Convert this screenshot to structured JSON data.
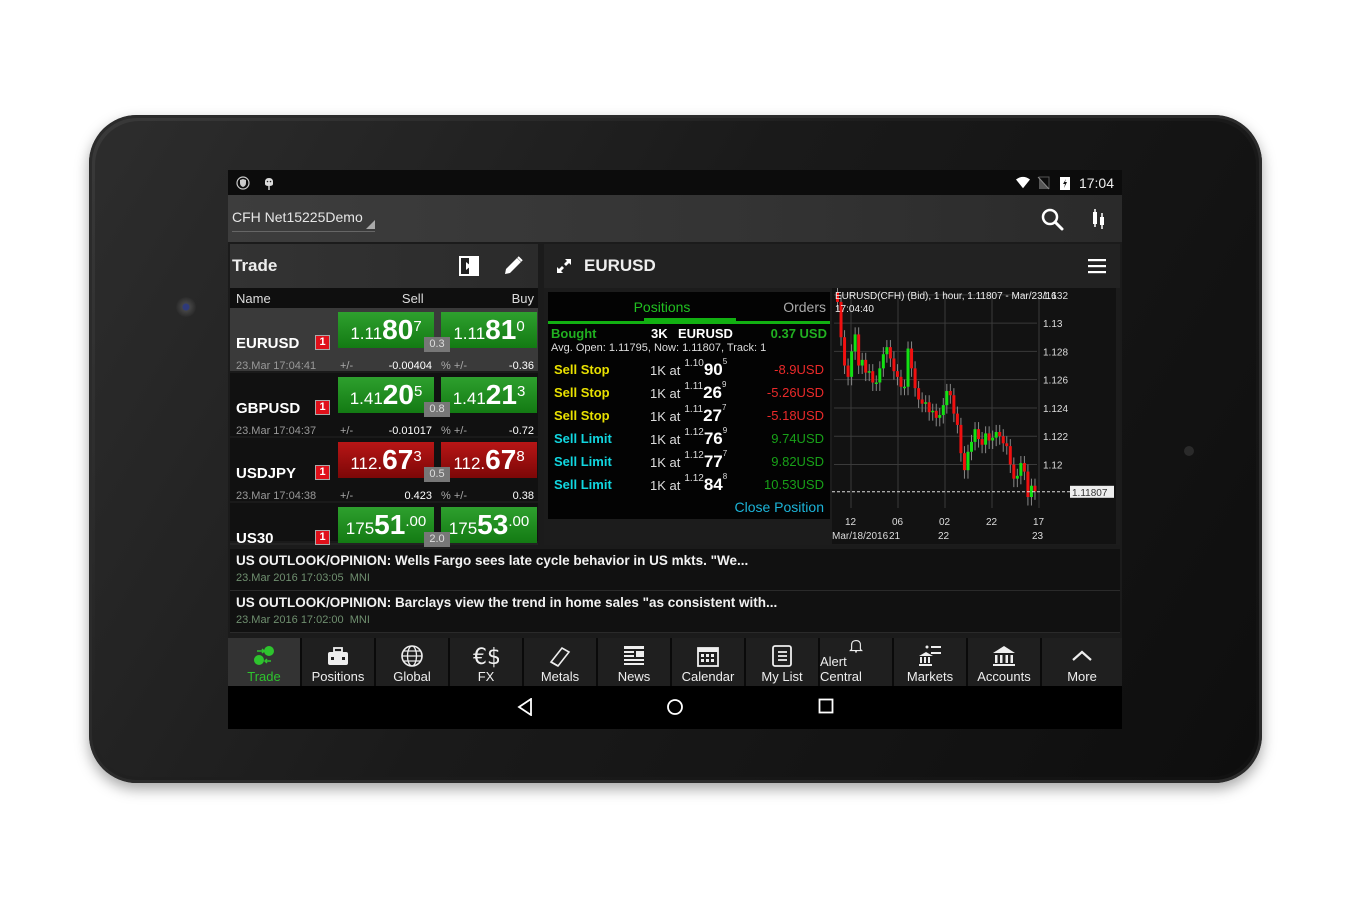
{
  "statusbar": {
    "time": "17:04",
    "left_icons": [
      "vpn-shield-icon",
      "android-icon"
    ],
    "right_icons": [
      "wifi-icon",
      "no-sim-icon",
      "battery-charging-icon"
    ]
  },
  "appbar": {
    "account": "CFH Net15225Demo",
    "actions": [
      "search-icon",
      "chart-type-icon"
    ]
  },
  "trade_panel": {
    "title": "Trade",
    "columns": {
      "name": "Name",
      "sell": "Sell",
      "buy": "Buy"
    },
    "rows": [
      {
        "name": "EURUSD",
        "badge": "1",
        "time": "23.Mar 17:04:41",
        "sell": {
          "pre": "1.11",
          "big": "80",
          "sup": "7"
        },
        "buy": {
          "pre": "1.11",
          "big": "81",
          "sup": "0"
        },
        "spread": "0.3",
        "pm_label": "+/-",
        "change": "-0.00404",
        "pct_label": "% +/-",
        "pct": "-0.36",
        "color": "green"
      },
      {
        "name": "GBPUSD",
        "badge": "1",
        "time": "23.Mar 17:04:37",
        "sell": {
          "pre": "1.41",
          "big": "20",
          "sup": "5"
        },
        "buy": {
          "pre": "1.41",
          "big": "21",
          "sup": "3"
        },
        "spread": "0.8",
        "pm_label": "+/-",
        "change": "-0.01017",
        "pct_label": "% +/-",
        "pct": "-0.72",
        "color": "green"
      },
      {
        "name": "USDJPY",
        "badge": "1",
        "time": "23.Mar 17:04:38",
        "sell": {
          "pre": "112.",
          "big": "67",
          "sup": "3"
        },
        "buy": {
          "pre": "112.",
          "big": "67",
          "sup": "8"
        },
        "spread": "0.5",
        "pm_label": "+/-",
        "change": "0.423",
        "pct_label": "% +/-",
        "pct": "0.38",
        "color": "red"
      },
      {
        "name": "US30",
        "badge": "1",
        "time": "",
        "sell": {
          "pre": "175",
          "big": "51",
          "sup": ".00"
        },
        "buy": {
          "pre": "175",
          "big": "53",
          "sup": ".00"
        },
        "spread": "2.0",
        "pm_label": "",
        "change": "",
        "pct_label": "",
        "pct": "",
        "color": "green"
      }
    ]
  },
  "detail_panel": {
    "symbol": "EURUSD",
    "tabs": {
      "positions": "Positions",
      "orders": "Orders",
      "active": "Positions"
    },
    "position": {
      "side": "Bought",
      "qty": "3K",
      "symbol": "EURUSD",
      "pl": "0.37 USD",
      "info": "Avg. Open: 1.11795, Now: 1.11807, Track: 1"
    },
    "orders": [
      {
        "type": "Sell Stop",
        "kind": "stop",
        "qty": "1K at",
        "lo": "1.10",
        "hi": "90",
        "sp": "5",
        "pl": "-8.9USD",
        "sign": "neg"
      },
      {
        "type": "Sell Stop",
        "kind": "stop",
        "qty": "1K at",
        "lo": "1.11",
        "hi": "26",
        "sp": "9",
        "pl": "-5.26USD",
        "sign": "neg"
      },
      {
        "type": "Sell Stop",
        "kind": "stop",
        "qty": "1K at",
        "lo": "1.11",
        "hi": "27",
        "sp": "7",
        "pl": "-5.18USD",
        "sign": "neg"
      },
      {
        "type": "Sell Limit",
        "kind": "limit",
        "qty": "1K at",
        "lo": "1.12",
        "hi": "76",
        "sp": "9",
        "pl": "9.74USD",
        "sign": "pos"
      },
      {
        "type": "Sell Limit",
        "kind": "limit",
        "qty": "1K at",
        "lo": "1.12",
        "hi": "77",
        "sp": "7",
        "pl": "9.82USD",
        "sign": "pos"
      },
      {
        "type": "Sell Limit",
        "kind": "limit",
        "qty": "1K at",
        "lo": "1.12",
        "hi": "84",
        "sp": "8",
        "pl": "10.53USD",
        "sign": "pos"
      }
    ],
    "close_label": "Close Position"
  },
  "chart_data": {
    "type": "candlestick",
    "title": "EURUSD(CFH) (Bid), 1 hour, 1.11807 - Mar/23/16 17:04:40",
    "ylim": [
      1.1165,
      1.1322
    ],
    "y_ticks": [
      "1.132",
      "1.13",
      "1.128",
      "1.126",
      "1.124",
      "1.122",
      "1.12"
    ],
    "y_tick_values": [
      1.132,
      1.13,
      1.128,
      1.126,
      1.124,
      1.122,
      1.12
    ],
    "current_price": "1.11807",
    "current_value": 1.11807,
    "x_ticks_top": [
      "12",
      "06",
      "02",
      "22",
      "17"
    ],
    "x_ticks_bottom": [
      "Mar/18/2016",
      "21",
      "22",
      "",
      "23"
    ],
    "grid": true,
    "series_close": [
      1.1315,
      1.129,
      1.127,
      1.1262,
      1.128,
      1.1292,
      1.127,
      1.1274,
      1.1265,
      1.1266,
      1.1258,
      1.1258,
      1.1268,
      1.1278,
      1.1283,
      1.1275,
      1.1266,
      1.1262,
      1.1255,
      1.1255,
      1.1282,
      1.1268,
      1.1254,
      1.1246,
      1.1243,
      1.1244,
      1.1237,
      1.1238,
      1.1233,
      1.1235,
      1.1242,
      1.1252,
      1.1249,
      1.1236,
      1.1228,
      1.1208,
      1.1196,
      1.1209,
      1.1216,
      1.1225,
      1.1218,
      1.1214,
      1.1222,
      1.1217,
      1.1219,
      1.1223,
      1.122,
      1.1215,
      1.1213,
      1.12,
      1.119,
      1.1192,
      1.1201,
      1.1195,
      1.1177,
      1.1185,
      1.1181
    ]
  },
  "news": [
    {
      "title": "US OUTLOOK/OPINION: Wells Fargo sees late cycle behavior in US mkts. \"We...",
      "time": "23.Mar 2016 17:03:05",
      "source": "MNI"
    },
    {
      "title": "US OUTLOOK/OPINION: Barclays view the trend in home sales \"as consistent with...",
      "time": "23.Mar 2016 17:02:00",
      "source": "MNI"
    }
  ],
  "bottom_nav": [
    {
      "label": "Trade",
      "icon": "trade-icon",
      "active": true
    },
    {
      "label": "Positions",
      "icon": "briefcase-icon"
    },
    {
      "label": "Global",
      "icon": "globe-icon"
    },
    {
      "label": "FX",
      "icon": "currency-icon"
    },
    {
      "label": "Metals",
      "icon": "gold-bar-icon"
    },
    {
      "label": "News",
      "icon": "newspaper-icon"
    },
    {
      "label": "Calendar",
      "icon": "calendar-icon"
    },
    {
      "label": "My List",
      "icon": "list-icon"
    },
    {
      "label": "Alert Central",
      "icon": "bell-icon"
    },
    {
      "label": "Markets",
      "icon": "markets-icon"
    },
    {
      "label": "Accounts",
      "icon": "bank-icon"
    },
    {
      "label": "More",
      "icon": "chevron-up-icon"
    }
  ],
  "system_nav": [
    "back-icon",
    "home-icon",
    "recents-icon"
  ],
  "colors": {
    "accent_green": "#21c021",
    "sell_stop": "#e8e000",
    "sell_limit": "#11d6e0",
    "loss": "#ea2a2a",
    "gain": "#18a018",
    "link": "#1cb4d8"
  }
}
